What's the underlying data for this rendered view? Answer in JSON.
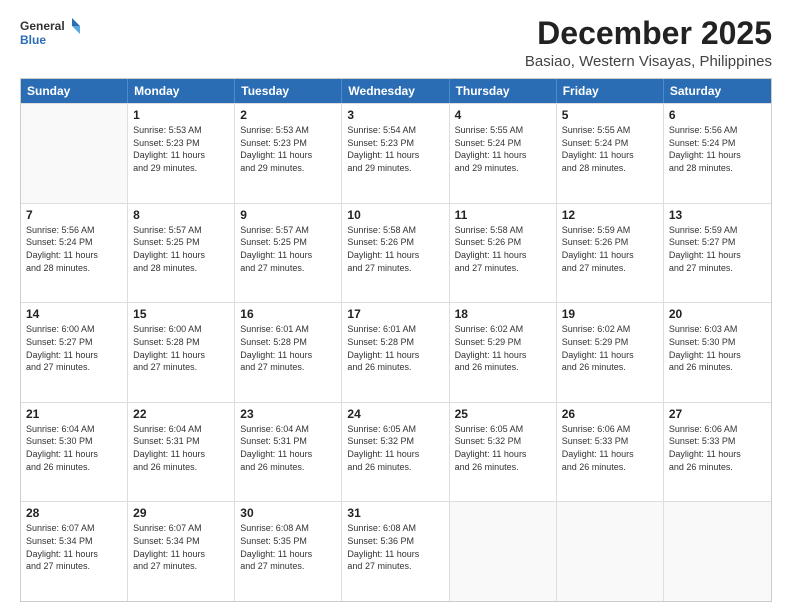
{
  "logo": {
    "line1": "General",
    "line2": "Blue"
  },
  "title": "December 2025",
  "subtitle": "Basiao, Western Visayas, Philippines",
  "headers": [
    "Sunday",
    "Monday",
    "Tuesday",
    "Wednesday",
    "Thursday",
    "Friday",
    "Saturday"
  ],
  "weeks": [
    [
      {
        "day": "",
        "info": ""
      },
      {
        "day": "1",
        "info": "Sunrise: 5:53 AM\nSunset: 5:23 PM\nDaylight: 11 hours\nand 29 minutes."
      },
      {
        "day": "2",
        "info": "Sunrise: 5:53 AM\nSunset: 5:23 PM\nDaylight: 11 hours\nand 29 minutes."
      },
      {
        "day": "3",
        "info": "Sunrise: 5:54 AM\nSunset: 5:23 PM\nDaylight: 11 hours\nand 29 minutes."
      },
      {
        "day": "4",
        "info": "Sunrise: 5:55 AM\nSunset: 5:24 PM\nDaylight: 11 hours\nand 29 minutes."
      },
      {
        "day": "5",
        "info": "Sunrise: 5:55 AM\nSunset: 5:24 PM\nDaylight: 11 hours\nand 28 minutes."
      },
      {
        "day": "6",
        "info": "Sunrise: 5:56 AM\nSunset: 5:24 PM\nDaylight: 11 hours\nand 28 minutes."
      }
    ],
    [
      {
        "day": "7",
        "info": "Sunrise: 5:56 AM\nSunset: 5:24 PM\nDaylight: 11 hours\nand 28 minutes."
      },
      {
        "day": "8",
        "info": "Sunrise: 5:57 AM\nSunset: 5:25 PM\nDaylight: 11 hours\nand 28 minutes."
      },
      {
        "day": "9",
        "info": "Sunrise: 5:57 AM\nSunset: 5:25 PM\nDaylight: 11 hours\nand 27 minutes."
      },
      {
        "day": "10",
        "info": "Sunrise: 5:58 AM\nSunset: 5:26 PM\nDaylight: 11 hours\nand 27 minutes."
      },
      {
        "day": "11",
        "info": "Sunrise: 5:58 AM\nSunset: 5:26 PM\nDaylight: 11 hours\nand 27 minutes."
      },
      {
        "day": "12",
        "info": "Sunrise: 5:59 AM\nSunset: 5:26 PM\nDaylight: 11 hours\nand 27 minutes."
      },
      {
        "day": "13",
        "info": "Sunrise: 5:59 AM\nSunset: 5:27 PM\nDaylight: 11 hours\nand 27 minutes."
      }
    ],
    [
      {
        "day": "14",
        "info": "Sunrise: 6:00 AM\nSunset: 5:27 PM\nDaylight: 11 hours\nand 27 minutes."
      },
      {
        "day": "15",
        "info": "Sunrise: 6:00 AM\nSunset: 5:28 PM\nDaylight: 11 hours\nand 27 minutes."
      },
      {
        "day": "16",
        "info": "Sunrise: 6:01 AM\nSunset: 5:28 PM\nDaylight: 11 hours\nand 27 minutes."
      },
      {
        "day": "17",
        "info": "Sunrise: 6:01 AM\nSunset: 5:28 PM\nDaylight: 11 hours\nand 26 minutes."
      },
      {
        "day": "18",
        "info": "Sunrise: 6:02 AM\nSunset: 5:29 PM\nDaylight: 11 hours\nand 26 minutes."
      },
      {
        "day": "19",
        "info": "Sunrise: 6:02 AM\nSunset: 5:29 PM\nDaylight: 11 hours\nand 26 minutes."
      },
      {
        "day": "20",
        "info": "Sunrise: 6:03 AM\nSunset: 5:30 PM\nDaylight: 11 hours\nand 26 minutes."
      }
    ],
    [
      {
        "day": "21",
        "info": "Sunrise: 6:04 AM\nSunset: 5:30 PM\nDaylight: 11 hours\nand 26 minutes."
      },
      {
        "day": "22",
        "info": "Sunrise: 6:04 AM\nSunset: 5:31 PM\nDaylight: 11 hours\nand 26 minutes."
      },
      {
        "day": "23",
        "info": "Sunrise: 6:04 AM\nSunset: 5:31 PM\nDaylight: 11 hours\nand 26 minutes."
      },
      {
        "day": "24",
        "info": "Sunrise: 6:05 AM\nSunset: 5:32 PM\nDaylight: 11 hours\nand 26 minutes."
      },
      {
        "day": "25",
        "info": "Sunrise: 6:05 AM\nSunset: 5:32 PM\nDaylight: 11 hours\nand 26 minutes."
      },
      {
        "day": "26",
        "info": "Sunrise: 6:06 AM\nSunset: 5:33 PM\nDaylight: 11 hours\nand 26 minutes."
      },
      {
        "day": "27",
        "info": "Sunrise: 6:06 AM\nSunset: 5:33 PM\nDaylight: 11 hours\nand 26 minutes."
      }
    ],
    [
      {
        "day": "28",
        "info": "Sunrise: 6:07 AM\nSunset: 5:34 PM\nDaylight: 11 hours\nand 27 minutes."
      },
      {
        "day": "29",
        "info": "Sunrise: 6:07 AM\nSunset: 5:34 PM\nDaylight: 11 hours\nand 27 minutes."
      },
      {
        "day": "30",
        "info": "Sunrise: 6:08 AM\nSunset: 5:35 PM\nDaylight: 11 hours\nand 27 minutes."
      },
      {
        "day": "31",
        "info": "Sunrise: 6:08 AM\nSunset: 5:36 PM\nDaylight: 11 hours\nand 27 minutes."
      },
      {
        "day": "",
        "info": ""
      },
      {
        "day": "",
        "info": ""
      },
      {
        "day": "",
        "info": ""
      }
    ]
  ]
}
